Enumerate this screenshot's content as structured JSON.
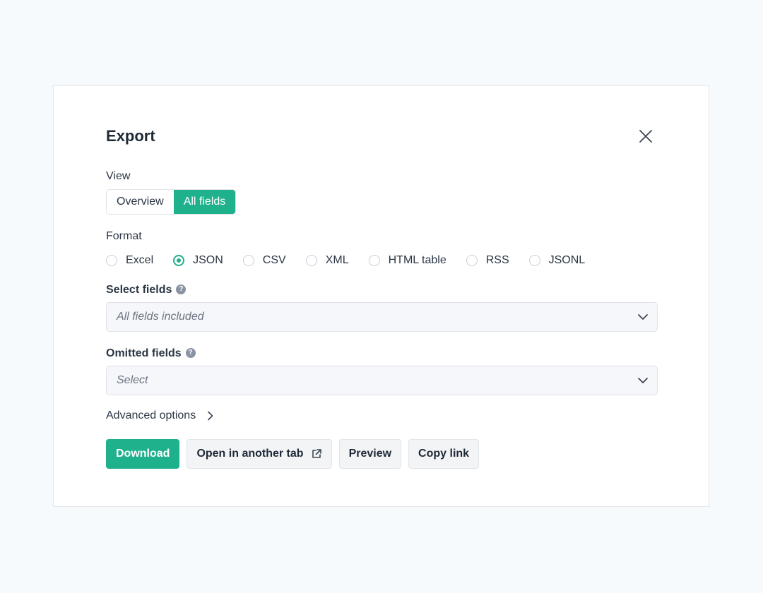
{
  "dialog": {
    "title": "Export"
  },
  "view": {
    "label": "View",
    "options": [
      "Overview",
      "All fields"
    ],
    "selected": "All fields"
  },
  "format": {
    "label": "Format",
    "options": [
      "Excel",
      "JSON",
      "CSV",
      "XML",
      "HTML table",
      "RSS",
      "JSONL"
    ],
    "selected": "JSON"
  },
  "select_fields": {
    "label": "Select fields",
    "placeholder": "All fields included"
  },
  "omitted_fields": {
    "label": "Omitted fields",
    "placeholder": "Select"
  },
  "advanced": {
    "label": "Advanced options"
  },
  "actions": {
    "download": "Download",
    "open_tab": "Open in another tab",
    "preview": "Preview",
    "copy_link": "Copy link"
  },
  "colors": {
    "accent": "#1fb08c",
    "background": "#f7fafc"
  },
  "icons": {
    "close": "close-icon",
    "help": "help-icon",
    "dropdown": "chevron-down-icon",
    "advanced": "chevron-right-icon",
    "external": "external-link-icon"
  }
}
